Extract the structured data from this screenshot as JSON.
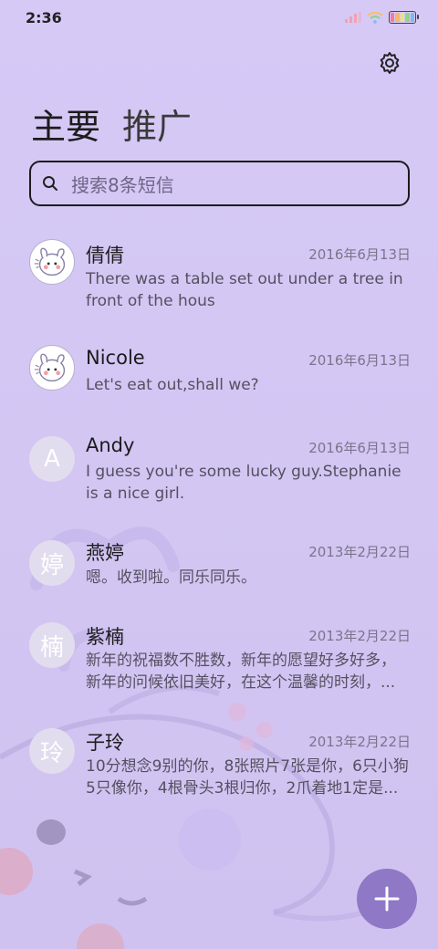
{
  "statusbar": {
    "time": "2:36",
    "battery_colors": [
      "#f27a9a",
      "#f7b76a",
      "#f3e36b",
      "#8fd58a",
      "#7fb8f0"
    ]
  },
  "icons": {
    "settings": "gear-icon",
    "search": "search-icon",
    "compose": "plus-icon"
  },
  "tabs": [
    {
      "label": "主要",
      "active": true
    },
    {
      "label": "推广",
      "active": false
    }
  ],
  "search": {
    "placeholder": "搜索8条短信"
  },
  "conversations": [
    {
      "name": "倩倩",
      "date": "2016年6月13日",
      "preview_lines": [
        "There was a table set out under a tree in",
        "front of the hous"
      ],
      "avatar_type": "image",
      "avatar_letter": ""
    },
    {
      "name": "Nicole",
      "date": "2016年6月13日",
      "preview_lines": [
        "Let's eat out,shall we?"
      ],
      "avatar_type": "image",
      "avatar_letter": ""
    },
    {
      "name": "Andy",
      "date": "2016年6月13日",
      "preview_lines": [
        "I guess you're some lucky guy.Stephanie",
        "is a nice girl."
      ],
      "avatar_type": "letter",
      "avatar_letter": "A"
    },
    {
      "name": "燕婷",
      "date": "2013年2月22日",
      "preview_lines": [
        "嗯。收到啦。同乐同乐。"
      ],
      "avatar_type": "letter",
      "avatar_letter": "婷"
    },
    {
      "name": "紫楠",
      "date": "2013年2月22日",
      "preview_lines": [
        "新年的祝福数不胜数，新年的愿望好多好多，",
        "新年的问候依旧美好，在这个温馨的时刻，..."
      ],
      "avatar_type": "letter",
      "avatar_letter": "楠"
    },
    {
      "name": "子玲",
      "date": "2013年2月22日",
      "preview_lines": [
        "10分想念9别的你，8张照片7张是你，6只小狗",
        "5只像你，4根骨头3根归你，2爪着地1定是..."
      ],
      "avatar_type": "letter",
      "avatar_letter": "玲"
    }
  ],
  "colors": {
    "accent": "#8f78c5",
    "background": "#d6c9f6"
  }
}
